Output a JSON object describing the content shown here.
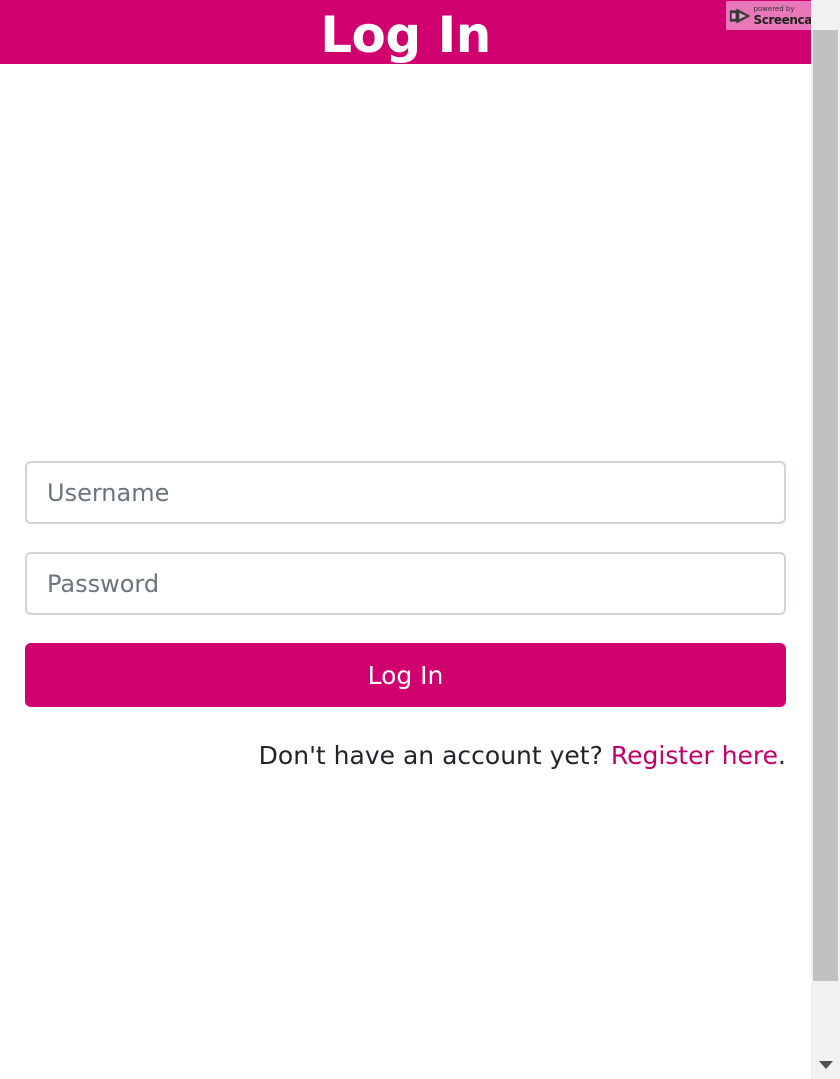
{
  "header": {
    "title": "Log In"
  },
  "watermark": {
    "small_text": "powered by",
    "brand": "Screencastify"
  },
  "form": {
    "username_placeholder": "Username",
    "password_placeholder": "Password",
    "submit_label": "Log In"
  },
  "register": {
    "prompt": "Don't have an account yet?",
    "link_text": "Register here",
    "suffix": "."
  },
  "colors": {
    "accent": "#d0006f",
    "link": "#c2006a",
    "input_border": "#ced4da",
    "text": "#212529"
  },
  "icons": {
    "watermark_logo": "screencastify-logo-icon",
    "scroll_down": "scroll-down-arrow-icon"
  }
}
